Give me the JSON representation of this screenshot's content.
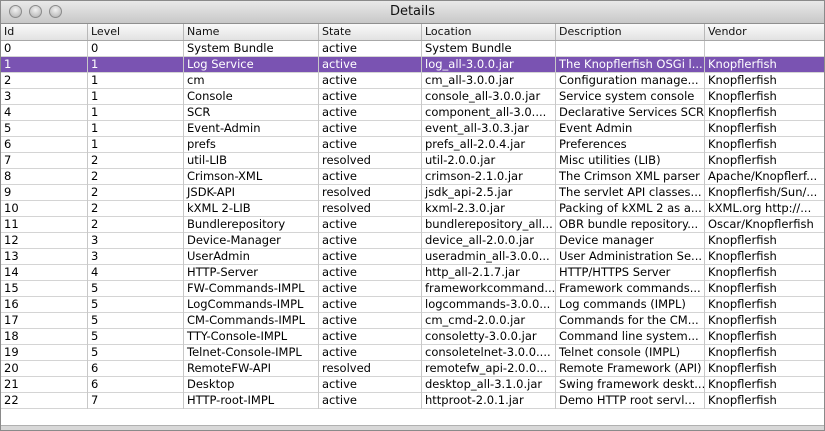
{
  "window": {
    "title": "Details"
  },
  "table": {
    "columns": [
      "Id",
      "Level",
      "Name",
      "State",
      "Location",
      "Description",
      "Vendor"
    ],
    "selected_row": 1,
    "rows": [
      [
        "0",
        "0",
        "System Bundle",
        "active",
        "System Bundle",
        "",
        ""
      ],
      [
        "1",
        "1",
        "Log Service",
        "active",
        "log_all-3.0.0.jar",
        "The Knopflerfish OSGi l...",
        "Knopflerfish"
      ],
      [
        "2",
        "1",
        "cm",
        "active",
        "cm_all-3.0.0.jar",
        "Configuration manage...",
        "Knopflerfish"
      ],
      [
        "3",
        "1",
        "Console",
        "active",
        "console_all-3.0.0.jar",
        "Service system console",
        "Knopflerfish"
      ],
      [
        "4",
        "1",
        "SCR",
        "active",
        "component_all-3.0....",
        "Declarative Services SCR",
        "Knopflerfish"
      ],
      [
        "5",
        "1",
        "Event-Admin",
        "active",
        "event_all-3.0.3.jar",
        "Event Admin",
        "Knopflerfish"
      ],
      [
        "6",
        "1",
        "prefs",
        "active",
        "prefs_all-2.0.4.jar",
        "Preferences",
        "Knopflerfish"
      ],
      [
        "7",
        "2",
        "util-LIB",
        "resolved",
        "util-2.0.0.jar",
        "Misc utilities (LIB)",
        "Knopflerfish"
      ],
      [
        "8",
        "2",
        "Crimson-XML",
        "active",
        "crimson-2.1.0.jar",
        "The Crimson XML parser",
        "Apache/Knopflerf..."
      ],
      [
        "9",
        "2",
        "JSDK-API",
        "resolved",
        "jsdk_api-2.5.jar",
        "The servlet API classes...",
        "Knopflerfish/Sun/..."
      ],
      [
        "10",
        "2",
        "kXML 2-LIB",
        "resolved",
        "kxml-2.3.0.jar",
        "Packing of kXML 2 as a...",
        "kXML.org  http://..."
      ],
      [
        "11",
        "2",
        "Bundlerepository",
        "active",
        "bundlerepository_all...",
        "OBR bundle repository...",
        "Oscar/Knopflerfish"
      ],
      [
        "12",
        "3",
        "Device-Manager",
        "active",
        "device_all-2.0.0.jar",
        "Device manager",
        "Knopflerfish"
      ],
      [
        "13",
        "3",
        "UserAdmin",
        "active",
        "useradmin_all-3.0.0...",
        "User Administration Se...",
        "Knopflerfish"
      ],
      [
        "14",
        "4",
        "HTTP-Server",
        "active",
        "http_all-2.1.7.jar",
        "HTTP/HTTPS Server",
        "Knopflerfish"
      ],
      [
        "15",
        "5",
        "FW-Commands-IMPL",
        "active",
        "frameworkcommand...",
        "Framework commands...",
        "Knopflerfish"
      ],
      [
        "16",
        "5",
        "LogCommands-IMPL",
        "active",
        "logcommands-3.0.0...",
        "Log commands (IMPL)",
        "Knopflerfish"
      ],
      [
        "17",
        "5",
        "CM-Commands-IMPL",
        "active",
        "cm_cmd-2.0.0.jar",
        "Commands for the CM...",
        "Knopflerfish"
      ],
      [
        "18",
        "5",
        "TTY-Console-IMPL",
        "active",
        "consoletty-3.0.0.jar",
        "Command line system...",
        "Knopflerfish"
      ],
      [
        "19",
        "5",
        "Telnet-Console-IMPL",
        "active",
        "consoletelnet-3.0.0....",
        "Telnet console (IMPL)",
        "Knopflerfish"
      ],
      [
        "20",
        "6",
        "RemoteFW-API",
        "resolved",
        "remotefw_api-2.0.0...",
        "Remote Framework (API)",
        "Knopflerfish"
      ],
      [
        "21",
        "6",
        "Desktop",
        "active",
        "desktop_all-3.1.0.jar",
        "Swing framework deskt...",
        "Knopflerfish"
      ],
      [
        "22",
        "7",
        "HTTP-root-IMPL",
        "active",
        "httproot-2.0.1.jar",
        "Demo HTTP root servl...",
        "Knopflerfish"
      ]
    ]
  }
}
